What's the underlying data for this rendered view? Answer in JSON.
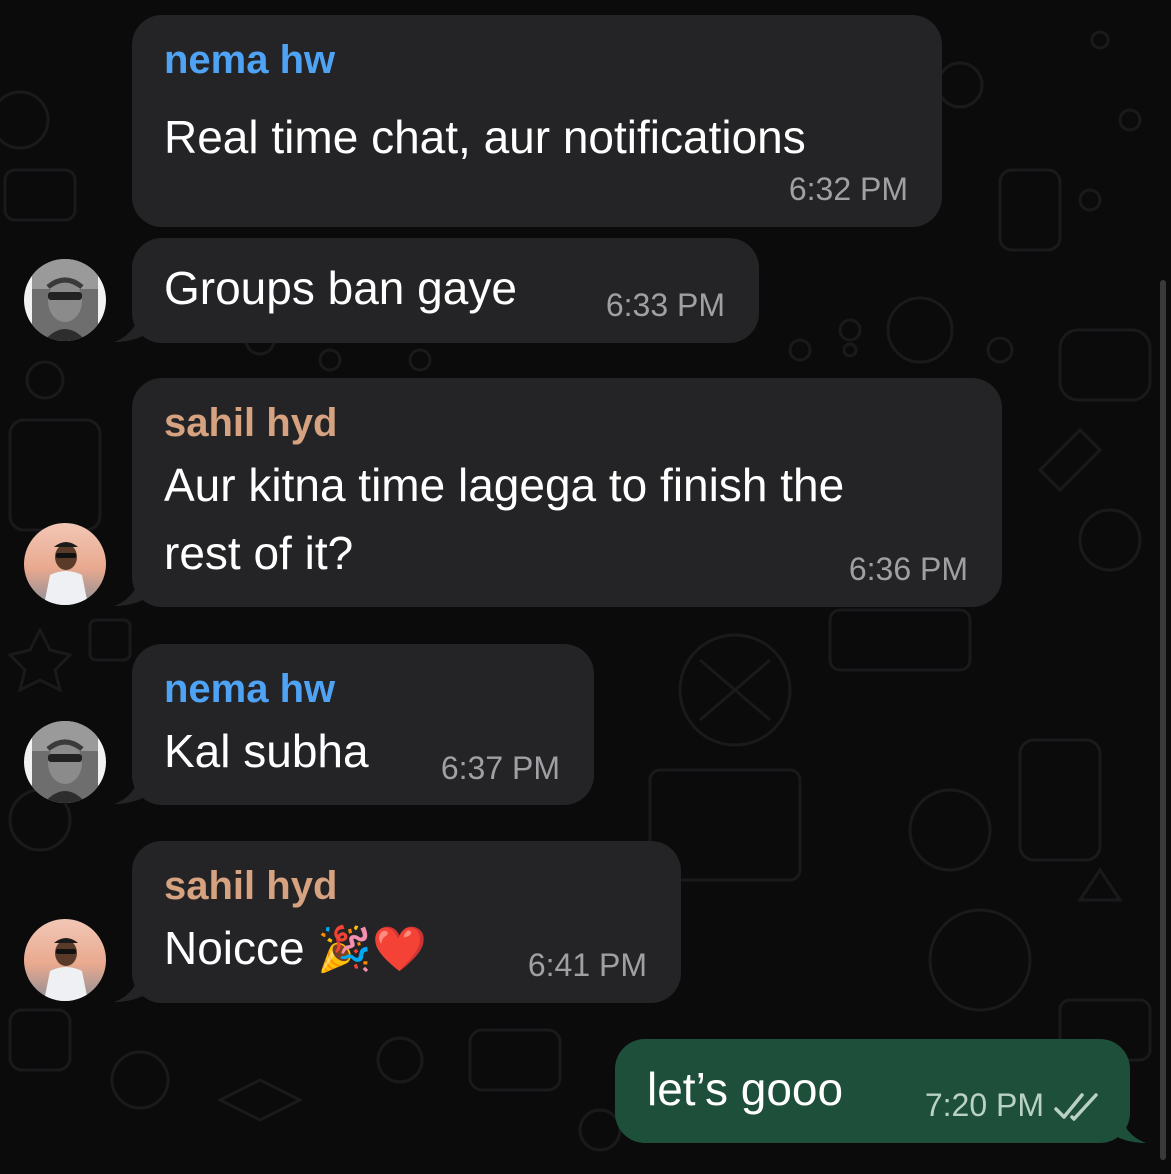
{
  "colors": {
    "background": "#0b0b0b",
    "incoming_bubble": "#242426",
    "outgoing_bubble": "#1e4f3b",
    "sender_nema": "#4ea3f5",
    "sender_sahil": "#d6a27f",
    "timestamp": "#a0a0a4"
  },
  "messages": [
    {
      "sender": "nema hw",
      "text": "Real time chat, aur notifications",
      "time": "6:32 PM",
      "direction": "incoming"
    },
    {
      "text": "Groups ban gaye",
      "time": "6:33 PM",
      "direction": "incoming",
      "avatar": "nema-avatar"
    },
    {
      "sender": "sahil hyd",
      "text_line1": "Aur kitna time lagega to finish the",
      "text_line2": "rest of it?",
      "time": "6:36 PM",
      "direction": "incoming",
      "avatar": "sahil-avatar"
    },
    {
      "sender": "nema hw",
      "text": "Kal subha",
      "time": "6:37 PM",
      "direction": "incoming",
      "avatar": "nema-avatar"
    },
    {
      "sender": "sahil hyd",
      "text": "Noicce",
      "emojis": "🎉❤️",
      "time": "6:41 PM",
      "direction": "incoming",
      "avatar": "sahil-avatar"
    },
    {
      "text": "let’s gooo",
      "time": "7:20 PM",
      "direction": "outgoing",
      "status_icon": "double-check-icon"
    }
  ]
}
